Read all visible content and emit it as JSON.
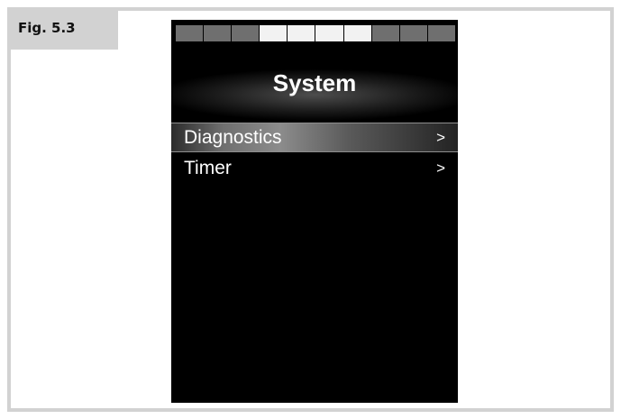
{
  "figure": {
    "label": "Fig. 5.3"
  },
  "colors": {
    "segment_dim": "#6f6f6f",
    "segment_lit": "#f2f2f2",
    "screen_background": "#000000",
    "frame": "#d2d2d2"
  },
  "battery_indicator": {
    "segments": [
      "dim",
      "dim",
      "dim",
      "lit",
      "lit",
      "lit",
      "lit",
      "dim",
      "dim",
      "dim"
    ]
  },
  "screen": {
    "title": "System",
    "menu": [
      {
        "label": "Diagnostics",
        "arrow": ">",
        "selected": true
      },
      {
        "label": "Timer",
        "arrow": ">",
        "selected": false
      }
    ]
  }
}
